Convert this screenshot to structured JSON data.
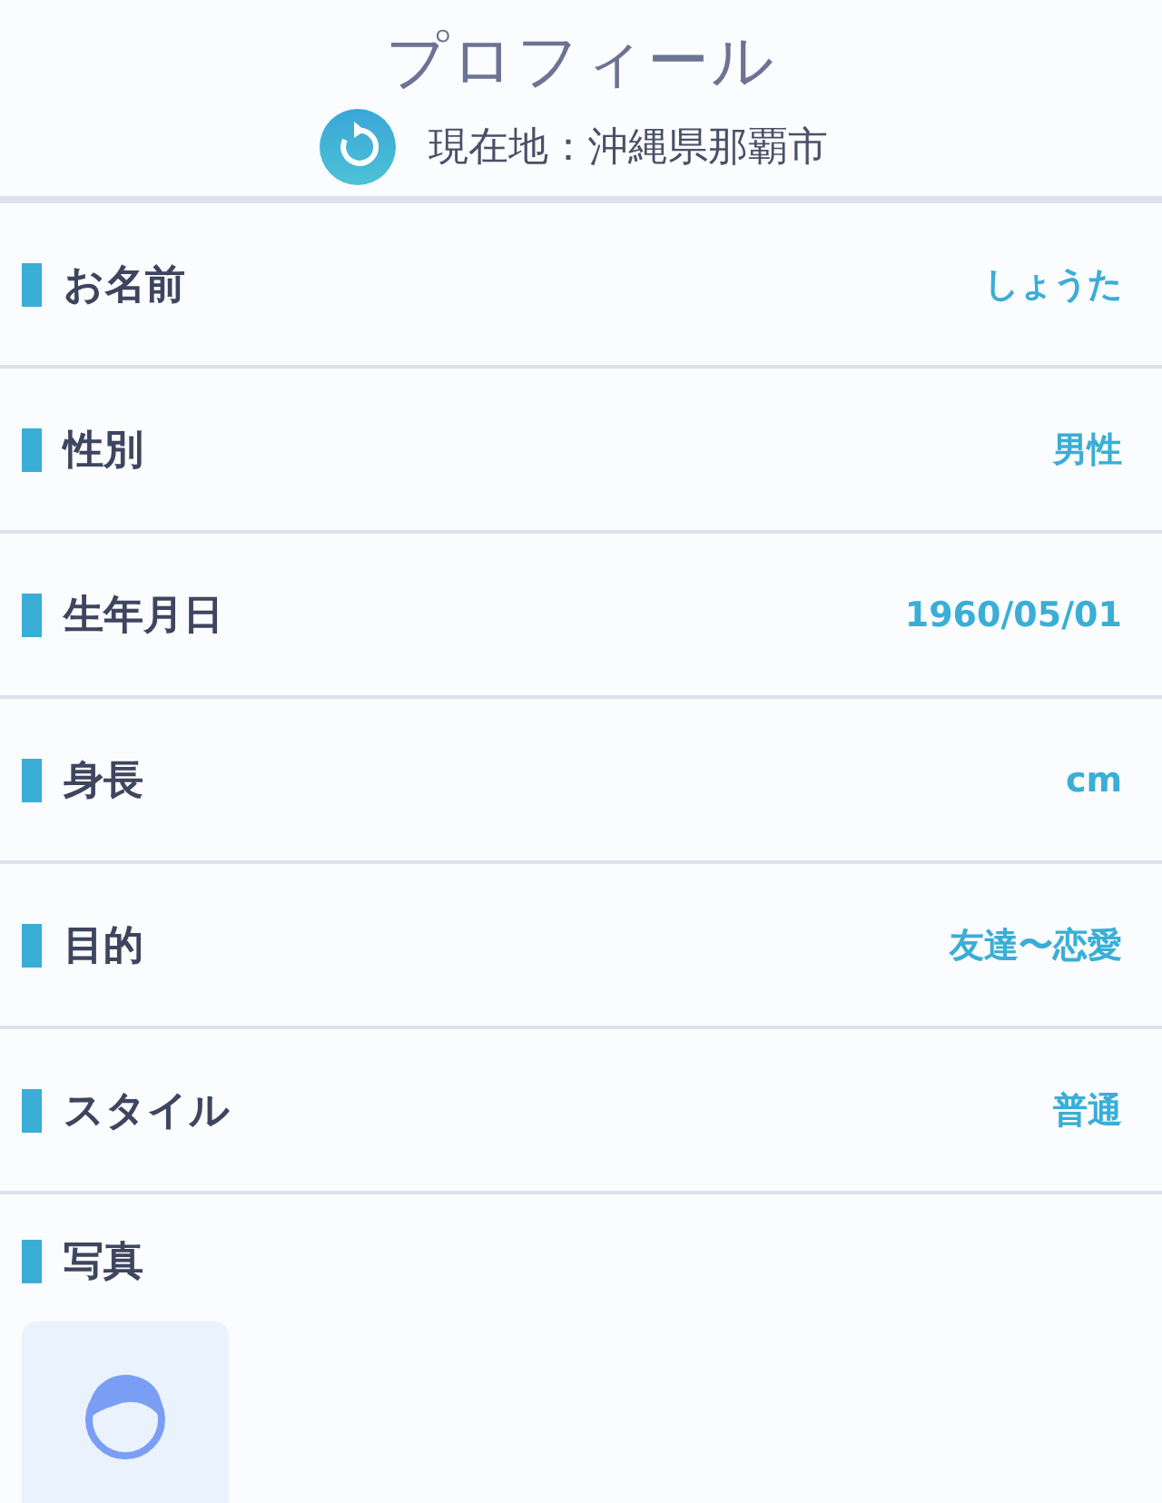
{
  "header": {
    "title": "プロフィール",
    "location": "現在地：沖縄県那覇市"
  },
  "fields": [
    {
      "label": "お名前",
      "value": "しょうた"
    },
    {
      "label": "性別",
      "value": "男性"
    },
    {
      "label": "生年月日",
      "value": "1960/05/01"
    },
    {
      "label": "身長",
      "value": "cm"
    },
    {
      "label": "目的",
      "value": "友達〜恋愛"
    },
    {
      "label": "スタイル",
      "value": "普通"
    }
  ],
  "photo": {
    "label": "写真"
  }
}
